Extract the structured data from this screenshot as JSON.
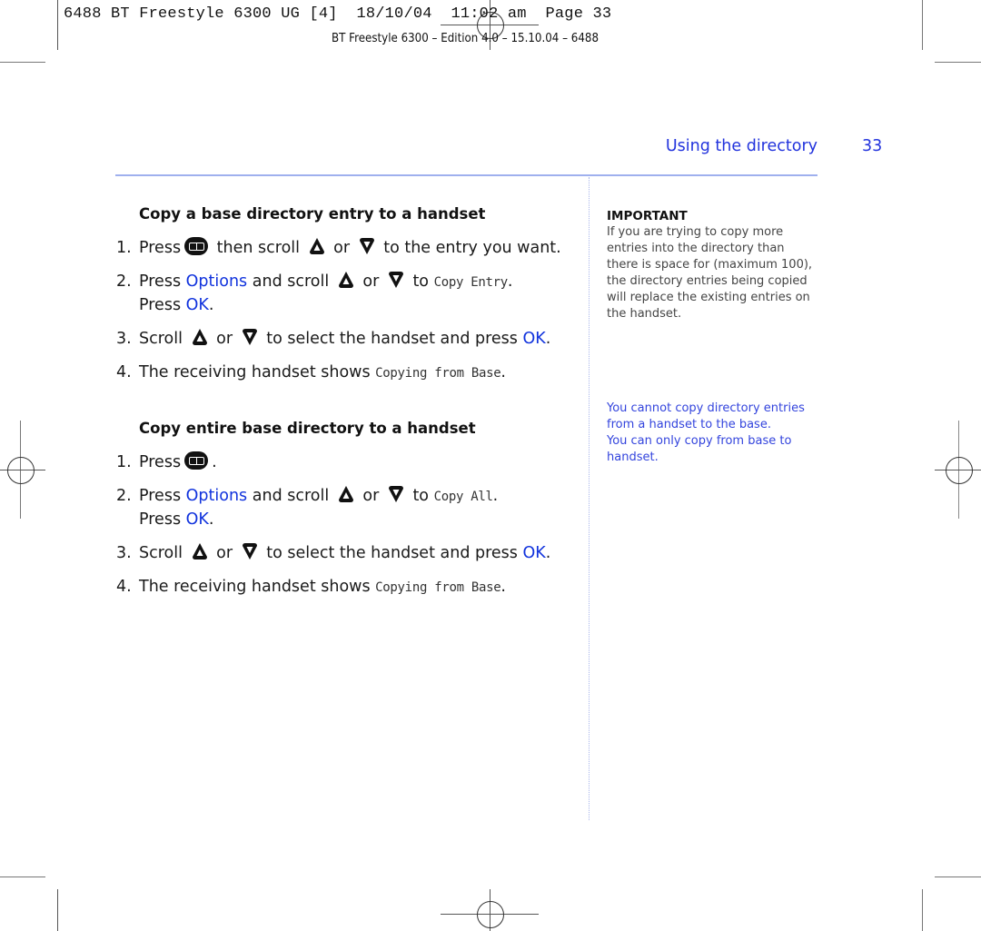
{
  "print_slug": "6488 BT Freestyle 6300 UG [4]  18/10/04  11:02 am  Page 33",
  "edition_line": "BT Freestyle 6300 – Edition 4.0 – 15.10.04 – 6488",
  "header": {
    "running_title": "Using the directory",
    "page_number": "33"
  },
  "colors": {
    "accent": "#2233dd",
    "rule": "#9fb0ee"
  },
  "section1": {
    "heading": "Copy a base directory entry to a handset",
    "steps": [
      {
        "num": "1.",
        "parts": [
          "Press",
          "then scroll",
          "or",
          "to the entry you want."
        ]
      },
      {
        "num": "2.",
        "parts": [
          "Press",
          "Options",
          "and scroll",
          "or",
          "to",
          "Copy Entry",
          ".",
          "Press",
          "OK",
          "."
        ]
      },
      {
        "num": "3.",
        "parts": [
          "Scroll",
          "or",
          "to select the handset and press",
          "OK",
          "."
        ]
      },
      {
        "num": "4.",
        "parts": [
          "The receiving handset shows",
          "Copying from Base",
          "."
        ]
      }
    ]
  },
  "section2": {
    "heading": "Copy entire base directory to a handset",
    "steps": [
      {
        "num": "1.",
        "parts": [
          "Press",
          "."
        ]
      },
      {
        "num": "2.",
        "parts": [
          "Press",
          "Options",
          "and scroll",
          "or",
          "to",
          "Copy All",
          ".",
          "Press",
          "OK",
          "."
        ]
      },
      {
        "num": "3.",
        "parts": [
          "Scroll",
          "or",
          "to select the handset and press",
          "OK",
          "."
        ]
      },
      {
        "num": "4.",
        "parts": [
          "The receiving handset shows",
          "Copying from Base",
          "."
        ]
      }
    ]
  },
  "sidebar": {
    "important_heading": "IMPORTANT",
    "important_text": "If you are trying to copy more entries into the directory than there is space for (maximum 100), the directory entries being copied will replace the existing entries on the handset.",
    "note_lines": [
      "You cannot copy directory entries from a handset to the base.",
      "You can only copy from base to handset."
    ]
  },
  "icons": {
    "directory": "directory-book-icon",
    "up": "scroll-up-icon",
    "down": "scroll-down-icon"
  }
}
